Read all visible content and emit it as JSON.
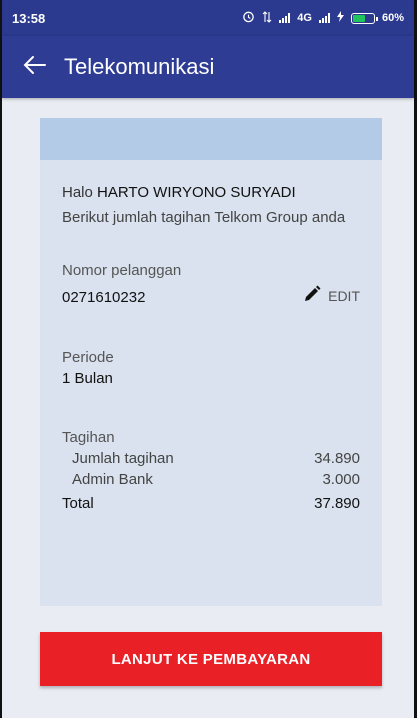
{
  "status_bar": {
    "time": "13:58",
    "network": "4G",
    "battery": "60%",
    "battery_level": 0.6
  },
  "app_bar": {
    "title": "Telekomunikasi",
    "back_icon": "arrow-left-icon"
  },
  "card": {
    "greeting_prefix": "Halo",
    "customer_name": "HARTO WIRYONO SURYADI",
    "subtitle": "Berikut jumlah tagihan Telkom Group anda",
    "customer_number_label": "Nomor pelanggan",
    "customer_number": "0271610232",
    "edit_label": "EDIT",
    "edit_icon": "pencil-icon",
    "period_label": "Periode",
    "period_value": "1 Bulan",
    "billing_label": "Tagihan",
    "bill_amount_label": "Jumlah tagihan",
    "bill_amount": "34.890",
    "admin_fee_label": "Admin Bank",
    "admin_fee": "3.000",
    "total_label": "Total",
    "total": "37.890"
  },
  "actions": {
    "continue_label": "LANJUT KE PEMBAYARAN"
  },
  "colors": {
    "app_bar": "#2e3c94",
    "card_header": "#b3cbe6",
    "card_bg": "#d9e2ee",
    "primary_button": "#ea2027"
  }
}
